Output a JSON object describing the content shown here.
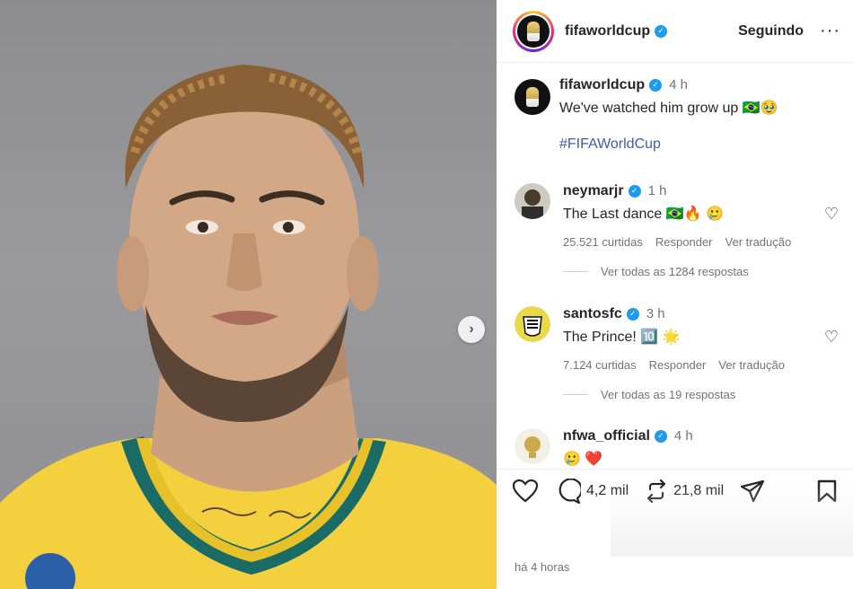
{
  "post": {
    "username": "fifaworldcup",
    "follow_label": "Seguindo",
    "more_label": "···",
    "caption_time": "4 h",
    "caption_text": "We've watched him grow up 🇧🇷🥹",
    "hashtag": "#FIFAWorldCup",
    "timestamp": "há 4 horas"
  },
  "comments": [
    {
      "username": "neymarjr",
      "time": "1 h",
      "text": "The Last dance 🇧🇷🔥 🥲",
      "likes": "25.521 curtidas",
      "reply_label": "Responder",
      "translate_label": "Ver tradução",
      "replies": "Ver todas as 1284 respostas"
    },
    {
      "username": "santosfc",
      "time": "3 h",
      "text": "The Prince! 🔟 🌟",
      "likes": "7.124 curtidas",
      "reply_label": "Responder",
      "translate_label": "Ver tradução",
      "replies": "Ver todas as 19 respostas"
    },
    {
      "username": "nfwa_official",
      "time": "4 h",
      "text": "🥲 ❤️"
    }
  ],
  "actions": {
    "comments_count": "4,2 mil",
    "reposts_count": "21,8 mil"
  },
  "colors": {
    "verified": "#1d9bf0",
    "hashtag": "#3f5bb5",
    "jersey_yellow": "#f4d03f",
    "jersey_collar": "#1a6b66",
    "background_gray": "#9a9a9c"
  },
  "icons": [
    "verified-icon",
    "heart-icon",
    "comment-icon",
    "repost-icon",
    "share-icon",
    "bookmark-icon",
    "chevron-right-icon",
    "more-icon"
  ]
}
